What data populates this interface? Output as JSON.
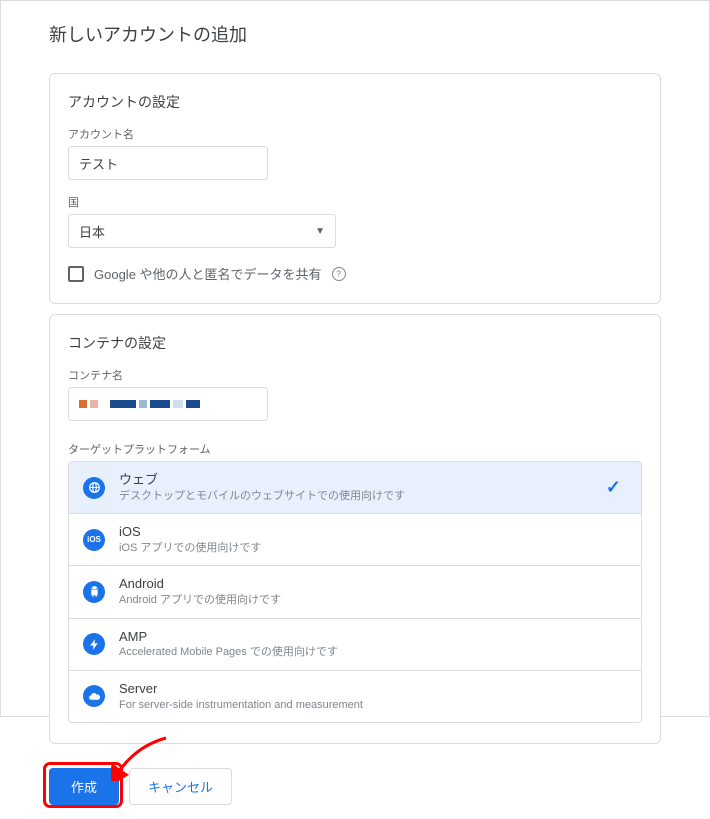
{
  "page_title": "新しいアカウントの追加",
  "account": {
    "section_title": "アカウントの設定",
    "name_label": "アカウント名",
    "name_value": "テスト",
    "country_label": "国",
    "country_value": "日本",
    "share_checkbox_label": "Google や他の人と匿名でデータを共有"
  },
  "container": {
    "section_title": "コンテナの設定",
    "name_label": "コンテナ名",
    "platform_label": "ターゲットプラットフォーム",
    "platforms": [
      {
        "name": "ウェブ",
        "desc": "デスクトップとモバイルのウェブサイトでの使用向けです",
        "color": "#1a73e8",
        "selected": true
      },
      {
        "name": "iOS",
        "desc": "iOS アプリでの使用向けです",
        "color": "#1a73e8",
        "selected": false
      },
      {
        "name": "Android",
        "desc": "Android アプリでの使用向けです",
        "color": "#1a73e8",
        "selected": false
      },
      {
        "name": "AMP",
        "desc": "Accelerated Mobile Pages での使用向けです",
        "color": "#1a73e8",
        "selected": false
      },
      {
        "name": "Server",
        "desc": "For server-side instrumentation and measurement",
        "color": "#1a73e8",
        "selected": false
      }
    ]
  },
  "buttons": {
    "create": "作成",
    "cancel": "キャンセル"
  }
}
